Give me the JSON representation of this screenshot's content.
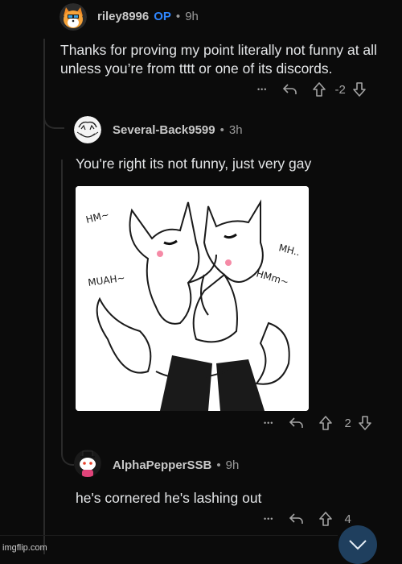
{
  "comments": [
    {
      "username": "riley8996",
      "op_badge": "OP",
      "separator": "•",
      "time": "9h",
      "text": "Thanks for proving my point literally not funny at all unless you’re from tttt or one of its discords.",
      "more": "•••",
      "score": "-2"
    },
    {
      "username": "Several-Back9599",
      "separator": "•",
      "time": "3h",
      "text": "You're right its not funny, just very gay",
      "more": "•••",
      "score": "2",
      "image": {
        "captions": [
          "HM~",
          "MUAH~",
          "MH..",
          "HMm~"
        ]
      }
    },
    {
      "username": "AlphaPepperSSB",
      "separator": "•",
      "time": "9h",
      "text": "he's cornered he's lashing out",
      "more": "•••",
      "score": "4"
    }
  ],
  "watermark": "imgflip.com",
  "icons": {
    "reply": "reply-arrow-icon",
    "upvote": "upvote-arrow-icon",
    "downvote": "downvote-arrow-icon",
    "scroll": "chevron-down-icon"
  },
  "colors": {
    "background": "#0b0b0b",
    "op_badge": "#2f86ff",
    "scroll_button": "#1f3f5e"
  }
}
